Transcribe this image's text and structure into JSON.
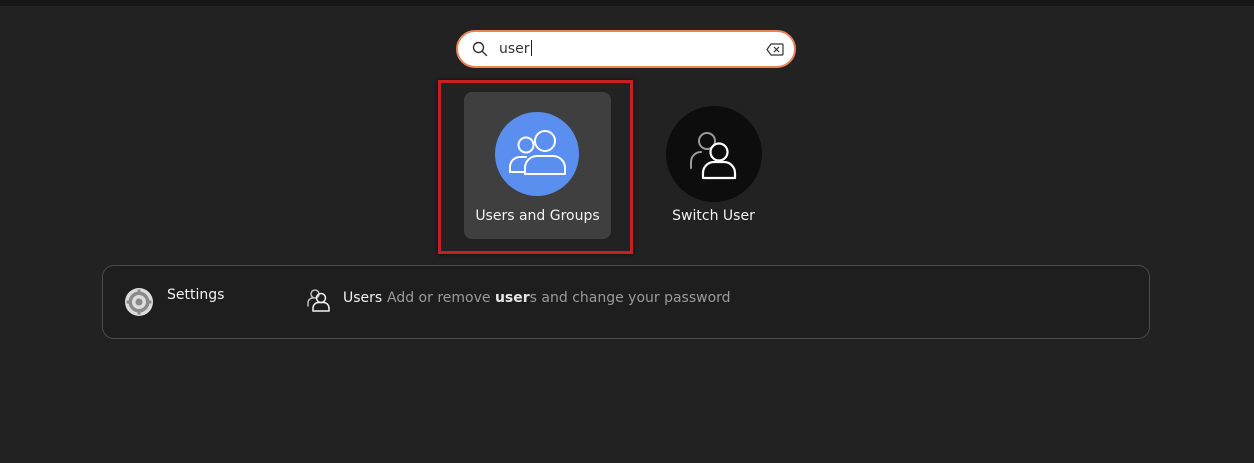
{
  "search": {
    "value": "user",
    "icon": "search-icon",
    "clear_icon": "backspace-clear-icon"
  },
  "apps": [
    {
      "label": "Users and Groups",
      "icon": "users-and-groups-icon",
      "icon_bg": "#5a8fef",
      "selected": true
    },
    {
      "label": "Switch User",
      "icon": "switch-user-icon",
      "icon_bg": "#0d0d0d",
      "selected": false
    }
  ],
  "results": {
    "provider": {
      "name": "Settings",
      "icon": "settings-gear-icon"
    },
    "items": [
      {
        "title": "Users",
        "icon": "user-icon",
        "description_before": "Add or remove ",
        "description_match": "user",
        "description_after": "s and change your password"
      }
    ]
  },
  "colors": {
    "background": "#222222",
    "search_border": "#e9835a",
    "highlight_box": "#c81f1f",
    "selected_tile": "#3f3f3f"
  }
}
